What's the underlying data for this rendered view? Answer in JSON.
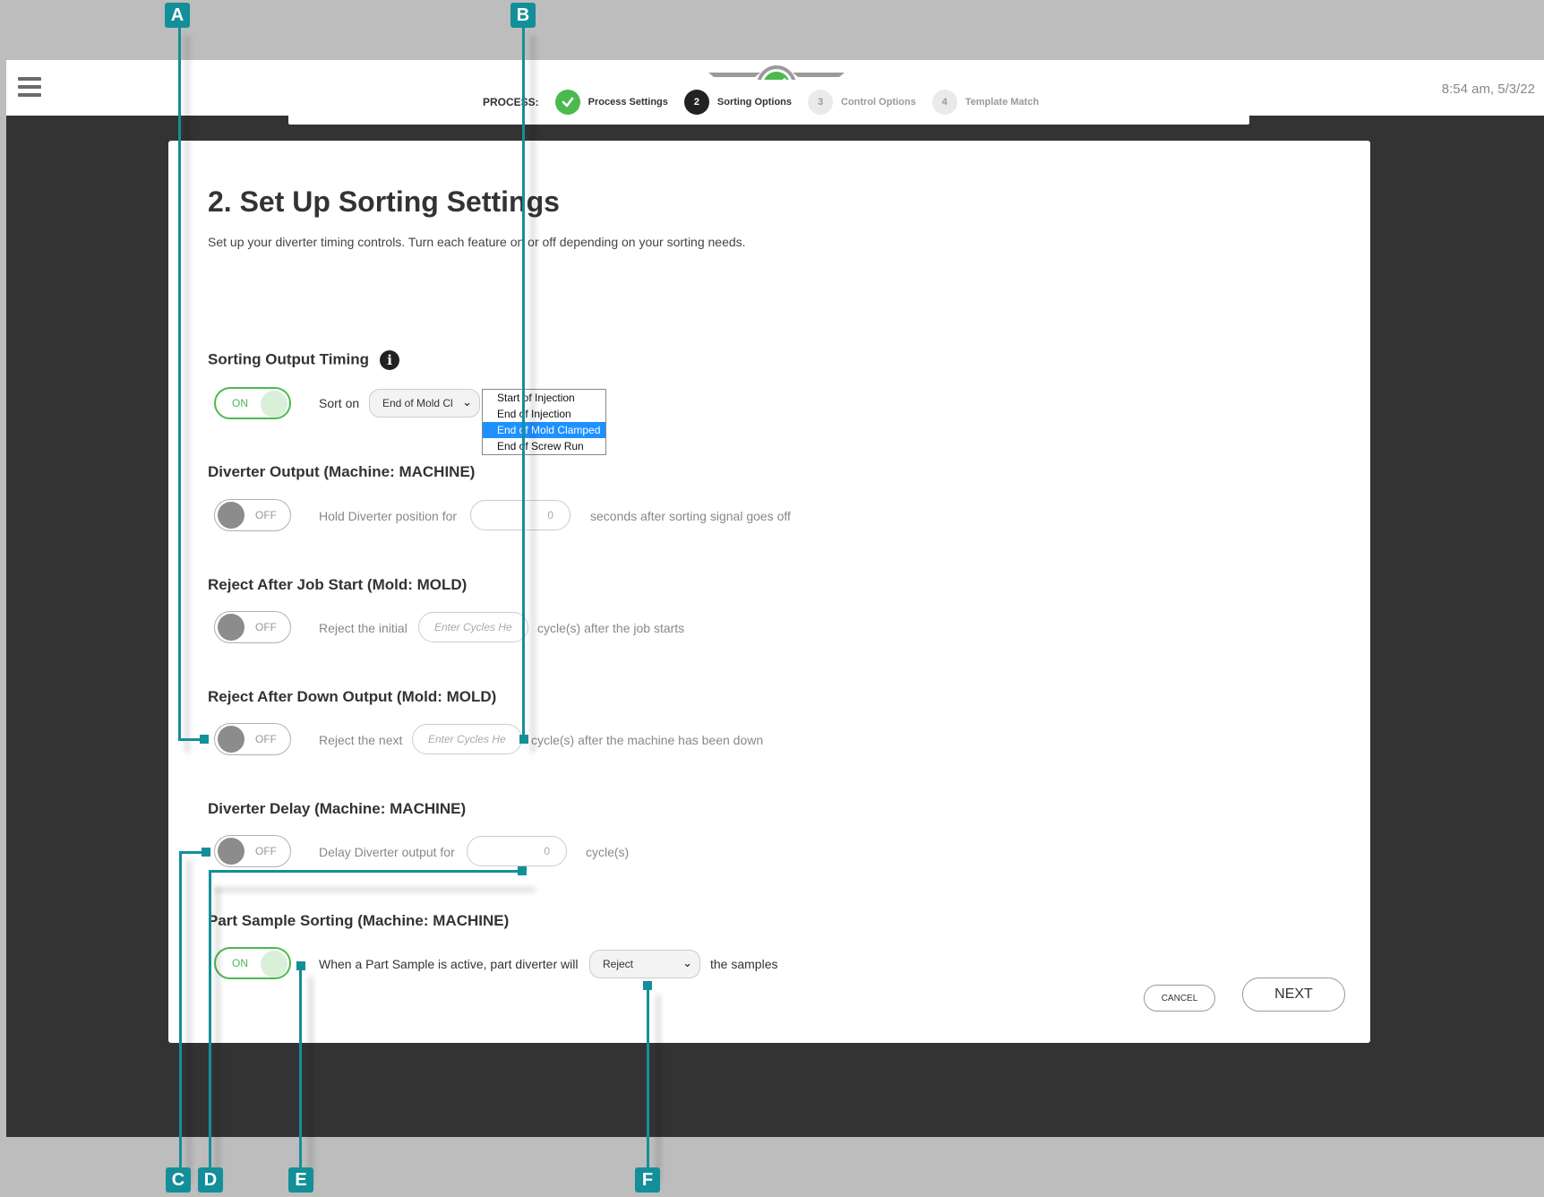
{
  "header": {
    "time": "8:54 am, 5/3/22"
  },
  "stepper": {
    "label": "PROCESS:",
    "steps": [
      {
        "num": "",
        "label": "Process Settings",
        "state": "done"
      },
      {
        "num": "2",
        "label": "Sorting Options",
        "state": "active"
      },
      {
        "num": "3",
        "label": "Control Options",
        "state": "pending"
      },
      {
        "num": "4",
        "label": "Template Match",
        "state": "pending"
      }
    ]
  },
  "page": {
    "title": "2. Set Up Sorting Settings",
    "subtitle": "Set up your diverter timing controls. Turn each feature on or off depending on your sorting needs."
  },
  "sections": {
    "sorting_output_timing": {
      "heading": "Sorting Output Timing",
      "toggle": "ON",
      "sort_on_label": "Sort on",
      "sort_on_value": "End of Mold Cl",
      "options": [
        "Start of Injection",
        "End of Injection",
        "End of Mold Clamped",
        "End of Screw Run"
      ],
      "selected_option": "End of Mold Clamped"
    },
    "diverter_output": {
      "heading": "Diverter Output (Machine: MACHINE)",
      "toggle": "OFF",
      "prefix": "Hold Diverter position for",
      "value": "0",
      "suffix": "seconds after sorting signal goes off"
    },
    "reject_after_job_start": {
      "heading": "Reject After Job Start (Mold: MOLD)",
      "toggle": "OFF",
      "prefix": "Reject the initial",
      "placeholder": "Enter Cycles He",
      "suffix": "cycle(s) after the job starts"
    },
    "reject_after_down_output": {
      "heading": "Reject After Down Output (Mold: MOLD)",
      "toggle": "OFF",
      "prefix": "Reject the next",
      "placeholder": "Enter Cycles He",
      "suffix": "cycle(s) after the machine has been down"
    },
    "diverter_delay": {
      "heading": "Diverter Delay (Machine: MACHINE)",
      "toggle": "OFF",
      "prefix": "Delay Diverter output for",
      "value": "0",
      "suffix": "cycle(s)"
    },
    "part_sample_sorting": {
      "heading": "Part Sample Sorting (Machine: MACHINE)",
      "toggle": "ON",
      "prefix": "When a Part Sample is active, part diverter will",
      "select_value": "Reject",
      "suffix": "the samples"
    }
  },
  "buttons": {
    "cancel": "CANCEL",
    "next": "NEXT"
  },
  "annotations": {
    "a": "A",
    "b": "B",
    "c": "C",
    "d": "D",
    "e": "E",
    "f": "F"
  },
  "colors": {
    "accent": "#138f99",
    "on": "#4cb94f",
    "selected": "#1e90ff",
    "app_bg": "#333333"
  },
  "icons": [
    "menu-icon",
    "logo-icon",
    "check-icon",
    "info-icon",
    "chevron-down-icon"
  ]
}
